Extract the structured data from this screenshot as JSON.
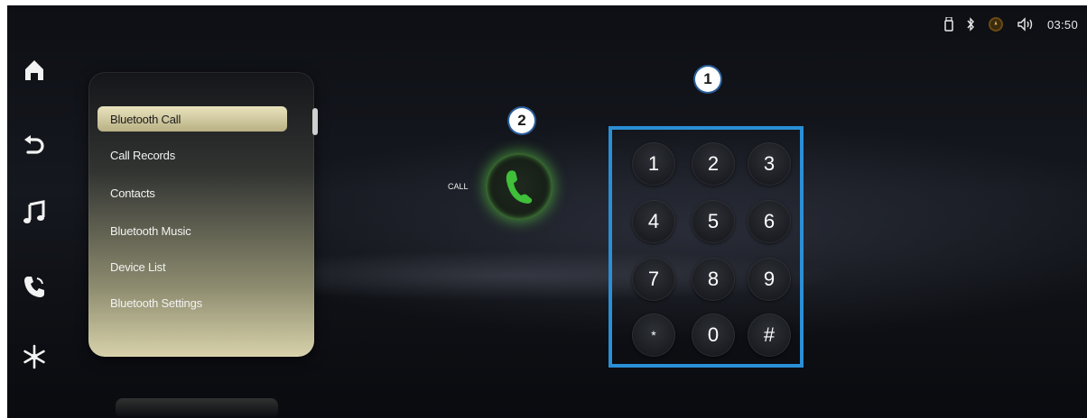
{
  "status_bar": {
    "icons": [
      "usb-icon",
      "bluetooth-icon",
      "navigation-icon",
      "volume-icon"
    ],
    "time": "03:50"
  },
  "rail": {
    "items": [
      {
        "icon": "home-icon"
      },
      {
        "icon": "back-icon"
      },
      {
        "icon": "music-icon"
      },
      {
        "icon": "phone-icon"
      },
      {
        "icon": "climate-icon"
      }
    ]
  },
  "menu": {
    "items": [
      {
        "label": "Bluetooth Call",
        "active": true
      },
      {
        "label": "Call Records",
        "active": false
      },
      {
        "label": "Contacts",
        "active": false
      },
      {
        "label": "Bluetooth Music",
        "active": false
      },
      {
        "label": "Device List",
        "active": false
      },
      {
        "label": "Bluetooth Settings",
        "active": false
      }
    ]
  },
  "call": {
    "label": "CALL",
    "icon": "phone-icon",
    "accent": "#3fbf3a"
  },
  "callouts": {
    "keypad": "1",
    "call_button": "2"
  },
  "keypad": {
    "keys": [
      "1",
      "2",
      "3",
      "4",
      "5",
      "6",
      "7",
      "8",
      "9",
      "*",
      "0",
      "#"
    ],
    "highlight_color": "#2a8fd6"
  }
}
